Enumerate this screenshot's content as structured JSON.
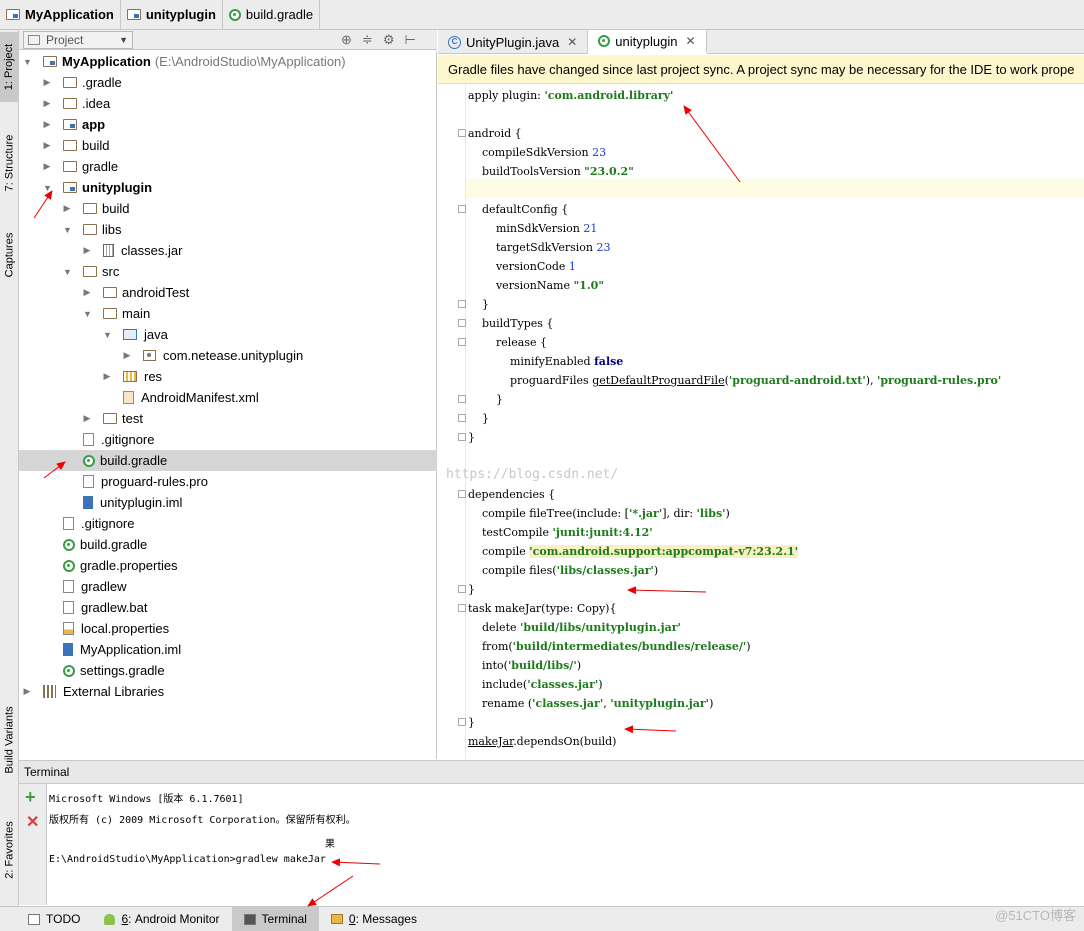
{
  "breadcrumbs": [
    "MyApplication",
    "unityplugin",
    "build.gradle"
  ],
  "left_strip": {
    "project": "1: Project",
    "structure": "7: Structure",
    "captures": "Captures",
    "build_variants": "Build Variants",
    "favorites": "2: Favorites"
  },
  "project_panel": {
    "view_mode": "Project"
  },
  "tree": [
    {
      "label": "MyApplication",
      "path": "(E:\\AndroidStudio\\MyApplication)",
      "indent": 0,
      "toggle": "open",
      "icon": "module",
      "bold": true
    },
    {
      "label": ".gradle",
      "indent": 1,
      "toggle": "closed",
      "icon": "folder"
    },
    {
      "label": ".idea",
      "indent": 1,
      "toggle": "closed",
      "icon": "folder"
    },
    {
      "label": "app",
      "indent": 1,
      "toggle": "closed",
      "icon": "module",
      "bold": true
    },
    {
      "label": "build",
      "indent": 1,
      "toggle": "closed",
      "icon": "folder"
    },
    {
      "label": "gradle",
      "indent": 1,
      "toggle": "closed",
      "icon": "folder"
    },
    {
      "label": "unityplugin",
      "indent": 1,
      "toggle": "open",
      "icon": "module",
      "bold": true
    },
    {
      "label": "build",
      "indent": 2,
      "toggle": "closed",
      "icon": "folder"
    },
    {
      "label": "libs",
      "indent": 2,
      "toggle": "open",
      "icon": "folder"
    },
    {
      "label": "classes.jar",
      "indent": 3,
      "toggle": "closed",
      "icon": "jar"
    },
    {
      "label": "src",
      "indent": 2,
      "toggle": "open",
      "icon": "folder"
    },
    {
      "label": "androidTest",
      "indent": 3,
      "toggle": "closed",
      "icon": "folder"
    },
    {
      "label": "main",
      "indent": 3,
      "toggle": "open",
      "icon": "folder"
    },
    {
      "label": "java",
      "indent": 4,
      "toggle": "open",
      "icon": "java"
    },
    {
      "label": "com.netease.unityplugin",
      "indent": 5,
      "toggle": "closed",
      "icon": "package"
    },
    {
      "label": "res",
      "indent": 4,
      "toggle": "closed",
      "icon": "res"
    },
    {
      "label": "AndroidManifest.xml",
      "indent": 4,
      "toggle": "none",
      "icon": "xml"
    },
    {
      "label": "test",
      "indent": 3,
      "toggle": "closed",
      "icon": "folder"
    },
    {
      "label": ".gitignore",
      "indent": 2,
      "toggle": "none",
      "icon": "file"
    },
    {
      "label": "build.gradle",
      "indent": 2,
      "toggle": "none",
      "icon": "gradle",
      "selected": true
    },
    {
      "label": "proguard-rules.pro",
      "indent": 2,
      "toggle": "none",
      "icon": "file"
    },
    {
      "label": "unityplugin.iml",
      "indent": 2,
      "toggle": "none",
      "icon": "iml"
    },
    {
      "label": ".gitignore",
      "indent": 1,
      "toggle": "none",
      "icon": "file"
    },
    {
      "label": "build.gradle",
      "indent": 1,
      "toggle": "none",
      "icon": "gradle"
    },
    {
      "label": "gradle.properties",
      "indent": 1,
      "toggle": "none",
      "icon": "gradle"
    },
    {
      "label": "gradlew",
      "indent": 1,
      "toggle": "none",
      "icon": "file"
    },
    {
      "label": "gradlew.bat",
      "indent": 1,
      "toggle": "none",
      "icon": "file"
    },
    {
      "label": "local.properties",
      "indent": 1,
      "toggle": "none",
      "icon": "prop"
    },
    {
      "label": "MyApplication.iml",
      "indent": 1,
      "toggle": "none",
      "icon": "iml"
    },
    {
      "label": "settings.gradle",
      "indent": 1,
      "toggle": "none",
      "icon": "gradle"
    },
    {
      "label": "External Libraries",
      "indent": 0,
      "toggle": "closed",
      "icon": "lib"
    }
  ],
  "editor_tabs": [
    {
      "label": "UnityPlugin.java",
      "active": false
    },
    {
      "label": "unityplugin",
      "active": true
    }
  ],
  "banner": "Gradle files have changed since last project sync. A project sync may be necessary for the IDE to work prope",
  "code_lines": [
    [
      [
        "apply ",
        ""
      ],
      [
        "plugin",
        ""
      ],
      [
        ": ",
        ""
      ],
      [
        "'com.android.library'",
        "str"
      ]
    ],
    [],
    [
      [
        "android {",
        ""
      ]
    ],
    [
      [
        "    compileSdkVersion ",
        ""
      ],
      [
        "23",
        "num"
      ]
    ],
    [
      [
        "    buildToolsVersion ",
        ""
      ],
      [
        "\"23.0.2\"",
        "str"
      ]
    ],
    [],
    [
      [
        "    defaultConfig {",
        ""
      ]
    ],
    [
      [
        "        minSdkVersion ",
        ""
      ],
      [
        "21",
        "num"
      ]
    ],
    [
      [
        "        targetSdkVersion ",
        ""
      ],
      [
        "23",
        "num"
      ]
    ],
    [
      [
        "        versionCode ",
        ""
      ],
      [
        "1",
        "num"
      ]
    ],
    [
      [
        "        versionName ",
        ""
      ],
      [
        "\"1.0\"",
        "str"
      ]
    ],
    [
      [
        "    }",
        ""
      ]
    ],
    [
      [
        "    buildTypes {",
        ""
      ]
    ],
    [
      [
        "        release {",
        ""
      ]
    ],
    [
      [
        "            minifyEnabled ",
        ""
      ],
      [
        "false",
        "kw"
      ]
    ],
    [
      [
        "            proguardFiles ",
        ""
      ],
      [
        "getDefaultProguardFile",
        "ul"
      ],
      [
        "(",
        ""
      ],
      [
        "'proguard-android.txt'",
        "str"
      ],
      [
        "), ",
        ""
      ],
      [
        "'proguard-rules.pro'",
        "str"
      ]
    ],
    [
      [
        "        }",
        ""
      ]
    ],
    [
      [
        "    }",
        ""
      ]
    ],
    [
      [
        "}",
        ""
      ]
    ],
    [],
    [],
    [
      [
        "dependencies {",
        ""
      ]
    ],
    [
      [
        "    compile fileTree(",
        ""
      ],
      [
        "include",
        ""
      ],
      [
        ": [",
        ""
      ],
      [
        "'*.jar'",
        "str"
      ],
      [
        "], ",
        ""
      ],
      [
        "dir",
        ""
      ],
      [
        ": ",
        ""
      ],
      [
        "'libs'",
        "str"
      ],
      [
        ")",
        ""
      ]
    ],
    [
      [
        "    testCompile ",
        ""
      ],
      [
        "'junit:junit:4.12'",
        "str"
      ]
    ],
    [
      [
        "    compile ",
        ""
      ],
      [
        "'com.android.support:appcompat-v7:23.2.1'",
        "str hlbox"
      ]
    ],
    [
      [
        "    compile files(",
        ""
      ],
      [
        "'libs/classes.jar'",
        "str"
      ],
      [
        ")",
        ""
      ]
    ],
    [
      [
        "}",
        ""
      ]
    ],
    [
      [
        "task makeJar(",
        ""
      ],
      [
        "type",
        ""
      ],
      [
        ": Copy){",
        ""
      ]
    ],
    [
      [
        "    delete ",
        ""
      ],
      [
        "'build/libs/unityplugin.jar'",
        "str"
      ]
    ],
    [
      [
        "    from(",
        ""
      ],
      [
        "'build/intermediates/bundles/release/'",
        "str"
      ],
      [
        ")",
        ""
      ]
    ],
    [
      [
        "    into(",
        ""
      ],
      [
        "'build/libs/'",
        "str"
      ],
      [
        ")",
        ""
      ]
    ],
    [
      [
        "    include(",
        ""
      ],
      [
        "'classes.jar'",
        "str"
      ],
      [
        ")",
        ""
      ]
    ],
    [
      [
        "    rename (",
        ""
      ],
      [
        "'classes.jar'",
        "str"
      ],
      [
        ", ",
        ""
      ],
      [
        "'unityplugin.jar'",
        "str"
      ],
      [
        ")",
        ""
      ]
    ],
    [
      [
        "}",
        ""
      ]
    ],
    [
      [
        "makeJar",
        "ul"
      ],
      [
        ".dependsOn(build)",
        ""
      ]
    ]
  ],
  "watermark_line": "https://blog.csdn.net/",
  "terminal": {
    "title": "Terminal",
    "lines": [
      "Microsoft Windows [版本 6.1.7601]",
      "版权所有 (c) 2009 Microsoft Corporation。保留所有权利。",
      "果",
      "E:\\AndroidStudio\\MyApplication>gradlew makeJar"
    ]
  },
  "bottom_tabs": [
    {
      "label": "TODO",
      "key": "",
      "icon": "todo"
    },
    {
      "label": "Android Monitor",
      "key": "6",
      "icon": "android"
    },
    {
      "label": "Terminal",
      "key": "",
      "icon": "terminal",
      "selected": true
    },
    {
      "label": "Messages",
      "key": "0",
      "icon": "messages"
    }
  ],
  "watermark": "@51CTO博客"
}
